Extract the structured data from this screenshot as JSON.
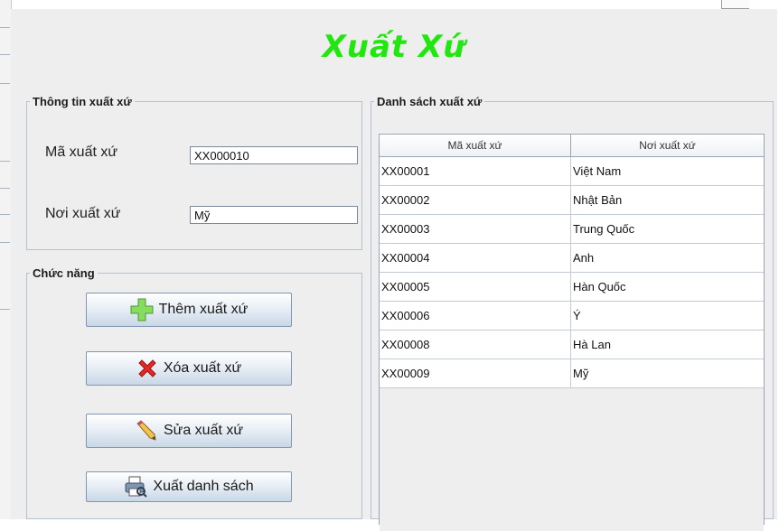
{
  "title": "Xuất Xứ",
  "info": {
    "legend": "Thông tin xuất xứ",
    "code_label": "Mã xuất xứ",
    "code_value": "XX000010",
    "origin_label": "Nơi xuất xứ",
    "origin_value": "Mỹ"
  },
  "functions": {
    "legend": "Chức năng",
    "add_label": "Thêm xuất xứ",
    "delete_label": "Xóa xuất xứ",
    "edit_label": "Sửa xuất xứ",
    "export_label": "Xuất danh sách"
  },
  "list": {
    "legend": "Danh sách xuất xứ",
    "columns": [
      "Mã xuất xứ",
      "Nơi xuất xứ"
    ],
    "rows": [
      [
        "XX00001",
        "Việt Nam"
      ],
      [
        "XX00002",
        "Nhật Bản"
      ],
      [
        "XX00003",
        "Trung Quốc"
      ],
      [
        "XX00004",
        "Anh"
      ],
      [
        "XX00005",
        "Hàn Quốc"
      ],
      [
        "XX00006",
        "Ý"
      ],
      [
        "XX00008",
        "Hà Lan"
      ],
      [
        "XX00009",
        "Mỹ"
      ]
    ]
  },
  "colors": {
    "title": "#22e60f",
    "add_icon": "#7ed957",
    "delete_icon": "#e02020"
  },
  "icons": {
    "add": "plus-icon",
    "delete": "x-icon",
    "edit": "pencil-icon",
    "export": "printer-icon"
  }
}
